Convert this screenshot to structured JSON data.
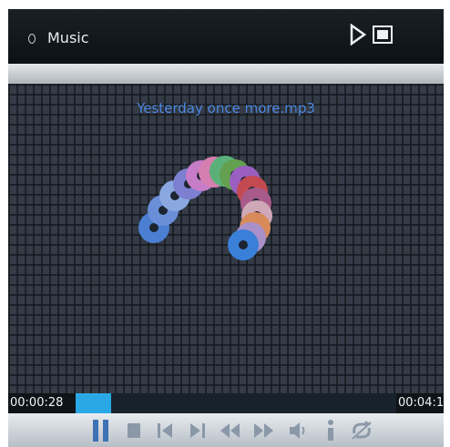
{
  "header": {
    "title": "Music",
    "icons": [
      "circle-icon",
      "play-icon",
      "battery-icon"
    ]
  },
  "player": {
    "song_title": "Yesterday once more.mp3",
    "elapsed": "00:00:28",
    "duration": "00:04:1",
    "progress_fraction": 0.11
  },
  "controls": [
    {
      "name": "pause-button",
      "icon": "pause-icon"
    },
    {
      "name": "stop-button",
      "icon": "stop-icon"
    },
    {
      "name": "previous-button",
      "icon": "skip-back-icon"
    },
    {
      "name": "next-button",
      "icon": "skip-forward-icon"
    },
    {
      "name": "rewind-button",
      "icon": "rewind-icon"
    },
    {
      "name": "fast-forward-button",
      "icon": "fast-forward-icon"
    },
    {
      "name": "volume-button",
      "icon": "speaker-icon"
    },
    {
      "name": "info-button",
      "icon": "info-icon"
    },
    {
      "name": "repeat-button",
      "icon": "repeat-icon"
    }
  ],
  "colors": {
    "accent": "#2aa8e6",
    "title_text": "#4c88e0",
    "icon_blue": "#4a78b8"
  }
}
